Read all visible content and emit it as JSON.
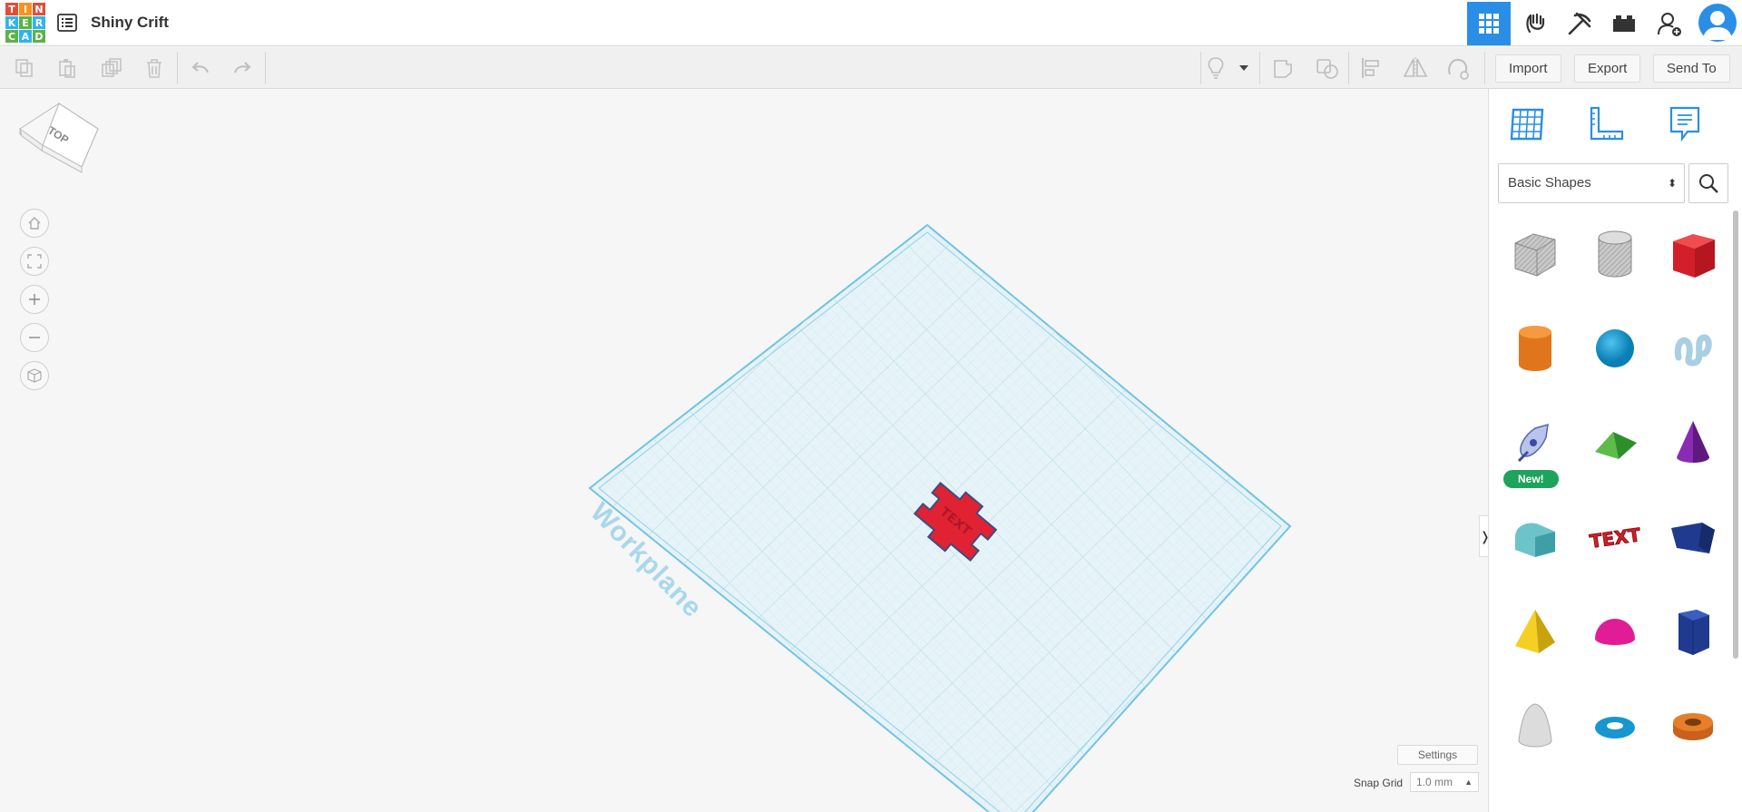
{
  "app": {
    "logo_letters": [
      "T",
      "I",
      "N",
      "K",
      "E",
      "R",
      "C",
      "A",
      "D"
    ],
    "project_title": "Shiny Crift"
  },
  "header": {
    "icons": [
      "3d-design-icon",
      "circuits-icon",
      "minecraft-icon",
      "lego-brick-icon",
      "add-user-icon",
      "avatar-icon"
    ]
  },
  "toolbar": {
    "import_label": "Import",
    "export_label": "Export",
    "send_to_label": "Send To"
  },
  "viewport": {
    "viewcube_face": "TOP",
    "workplane_label": "Workplane",
    "settings_label": "Settings",
    "snap_grid_label": "Snap Grid",
    "snap_grid_value": "1.0 mm"
  },
  "panel": {
    "shape_category": "Basic Shapes",
    "new_badge": "New!",
    "shapes": [
      "box-hole",
      "cylinder-hole",
      "box",
      "cylinder",
      "sphere",
      "scribble",
      "shape-generator",
      "roof",
      "cone",
      "round-roof",
      "text",
      "wedge",
      "pyramid",
      "half-sphere",
      "polygon",
      "paraboloid",
      "torus",
      "tube"
    ]
  },
  "colors": {
    "accent": "#2a8ee6",
    "workplane": "#e3f2f7",
    "workplane_edge": "#6fc3e3",
    "object_red": "#e02233",
    "new_badge": "#1da35b"
  }
}
